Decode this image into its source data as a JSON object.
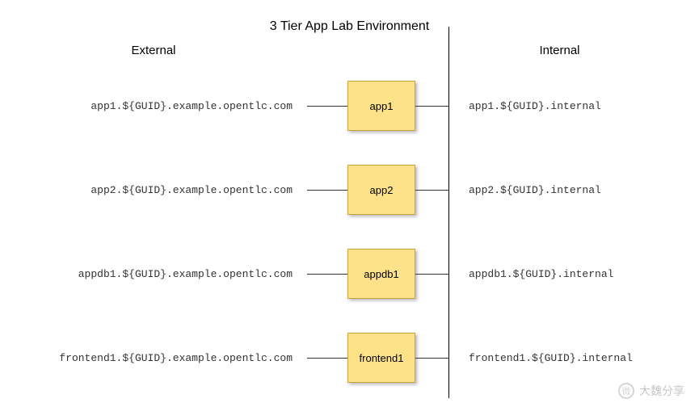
{
  "title": "3 Tier App Lab Environment",
  "columns": {
    "external": "External",
    "internal": "Internal"
  },
  "nodes": [
    {
      "name": "app1",
      "external": "app1.${GUID}.example.opentlc.com",
      "internal": "app1.${GUID}.internal"
    },
    {
      "name": "app2",
      "external": "app2.${GUID}.example.opentlc.com",
      "internal": "app2.${GUID}.internal"
    },
    {
      "name": "appdb1",
      "external": "appdb1.${GUID}.example.opentlc.com",
      "internal": "appdb1.${GUID}.internal"
    },
    {
      "name": "frontend1",
      "external": "frontend1.${GUID}.example.opentlc.com",
      "internal": "frontend1.${GUID}.internal"
    }
  ],
  "watermark": {
    "icon_label": "微",
    "text": "大魏分享"
  }
}
